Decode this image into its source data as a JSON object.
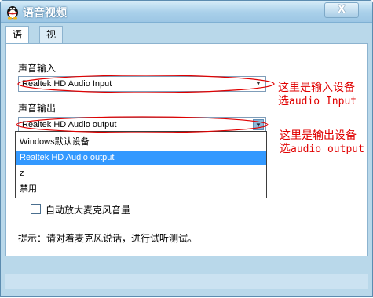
{
  "window": {
    "title": "语音视频",
    "close_label": "X"
  },
  "tabs": [
    {
      "label": "语音"
    },
    {
      "label": "视频"
    }
  ],
  "input_section": {
    "label": "声音输入",
    "selected": "Realtek HD Audio Input"
  },
  "output_section": {
    "label": "声音输出",
    "selected": "Realtek HD Audio output"
  },
  "output_options": [
    "Windows默认设备",
    "Realtek HD Audio output",
    "z",
    "禁用"
  ],
  "auto_amplify": {
    "label": "自动放大麦克风音量",
    "checked": false
  },
  "hint": "提示：请对着麦克风说话，进行试听测试。",
  "annotations": {
    "input_line1": "这里是输入设备",
    "input_line2_prefix": "选",
    "input_line2_latin": "audio Input",
    "output_line1": "这里是输出设备",
    "output_line2_prefix": "选",
    "output_line2_latin": "audio output"
  },
  "colors": {
    "annotation": "#e00000",
    "selection": "#3399ff",
    "window_frame": "#b9d8ea"
  },
  "icons": {
    "app": "penguin-icon",
    "close": "close-icon",
    "dropdown": "chevron-down-icon"
  }
}
